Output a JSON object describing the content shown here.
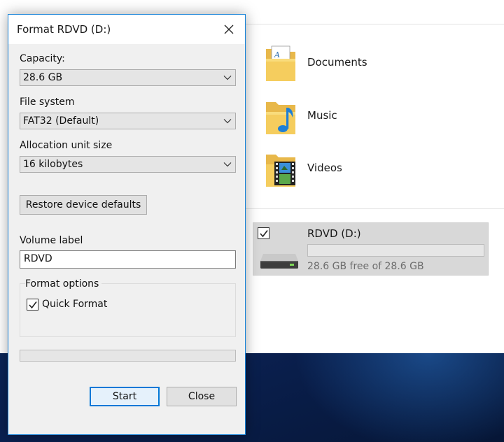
{
  "dialog": {
    "title": "Format RDVD (D:)",
    "capacity_label": "Capacity:",
    "capacity_value": "28.6 GB",
    "filesystem_label": "File system",
    "filesystem_value": "FAT32 (Default)",
    "allocation_label": "Allocation unit size",
    "allocation_value": "16 kilobytes",
    "restore_button": "Restore device defaults",
    "volume_label": "Volume label",
    "volume_value": "RDVD",
    "options_title": "Format options",
    "quick_format_label": "Quick Format",
    "quick_format_checked": true,
    "format_progress": 0,
    "start_button": "Start",
    "close_button": "Close",
    "accent_color": "#0078d7"
  },
  "explorer": {
    "folders": [
      {
        "label": "Documents",
        "icon": "documents-folder-icon"
      },
      {
        "label": "Music",
        "icon": "music-folder-icon"
      },
      {
        "label": "Videos",
        "icon": "videos-folder-icon"
      }
    ],
    "drive": {
      "name": "RDVD (D:)",
      "free_text": "28.6 GB free of 28.6 GB",
      "used_fraction": 0,
      "selected": true,
      "icon": "usb-drive-icon"
    }
  }
}
